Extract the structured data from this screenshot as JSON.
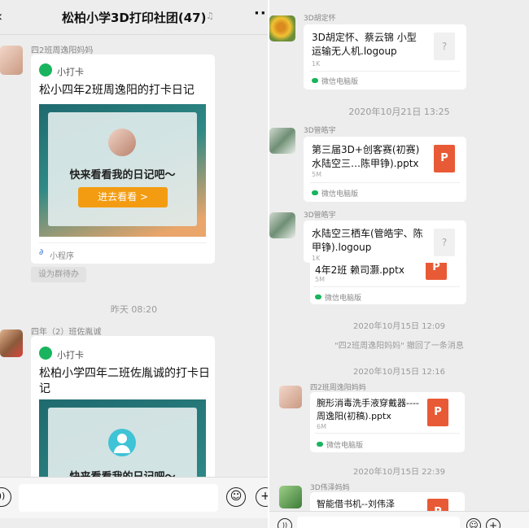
{
  "left": {
    "header": {
      "title": "松柏小学3D打印社团(47)",
      "back_icon": "chevron-left-icon",
      "more_icon": "ellipsis-icon"
    },
    "msg1": {
      "sender": "四2班周逸阳妈妈",
      "app": "小打卡",
      "title": "松小四年2班周逸阳的打卡日记",
      "banner_text": "快来看看我的日记吧～",
      "button": "进去看看 >",
      "footer": "小程序"
    },
    "set_todo": "设为群待办",
    "time1": "昨天 08:20",
    "msg2": {
      "sender": "四年（2）班佐胤诚",
      "app": "小打卡",
      "title": "松柏小学四年二班佐胤诚的打卡日记",
      "banner_text": "快来看看我的日记吧～"
    }
  },
  "right": {
    "msg1": {
      "sender": "3D胡定怀",
      "file": "3D胡定怀、蔡云锦 小型运输无人机.logoup",
      "size": "1K",
      "source": "微信电脑版"
    },
    "time1": "2020年10月21日 13:25",
    "msg2": {
      "sender": "3D管皓宇",
      "file": "第三届3D+创客赛(初赛)水陆空三…陈甲铮).pptx",
      "size": "5M",
      "source": "微信电脑版"
    },
    "msg3": {
      "sender": "3D管皓宇",
      "file": "水陆空三栖车(管皓宇、陈甲铮).logoup",
      "size": "1K"
    },
    "msg4": {
      "file": "4年2班 赖司灏.pptx",
      "size": "5M",
      "source": "微信电脑版"
    },
    "time2": "2020年10月15日 12:09",
    "recall": "\"四2班周逸阳妈妈\" 撤回了一条消息",
    "time3": "2020年10月15日 12:16",
    "msg5": {
      "sender": "四2班周逸阳妈妈",
      "file": "腕形消毒洗手液穿戴器----周逸阳(初稿).pptx",
      "size": "6M",
      "source": "微信电脑版"
    },
    "time4": "2020年10月15日 22:39",
    "msg6": {
      "sender": "3D伟泽妈妈",
      "file": "智能借书机--刘伟泽"
    }
  },
  "icons": {
    "ppt_letter": "P",
    "unknown_letter": "?"
  },
  "colors": {
    "accent_orange": "#f39c12",
    "ppt_red": "#e85a35",
    "wechat_green": "#19b45d",
    "mini_blue": "#3b6fd6",
    "teal_banner": "#2f7f84"
  }
}
